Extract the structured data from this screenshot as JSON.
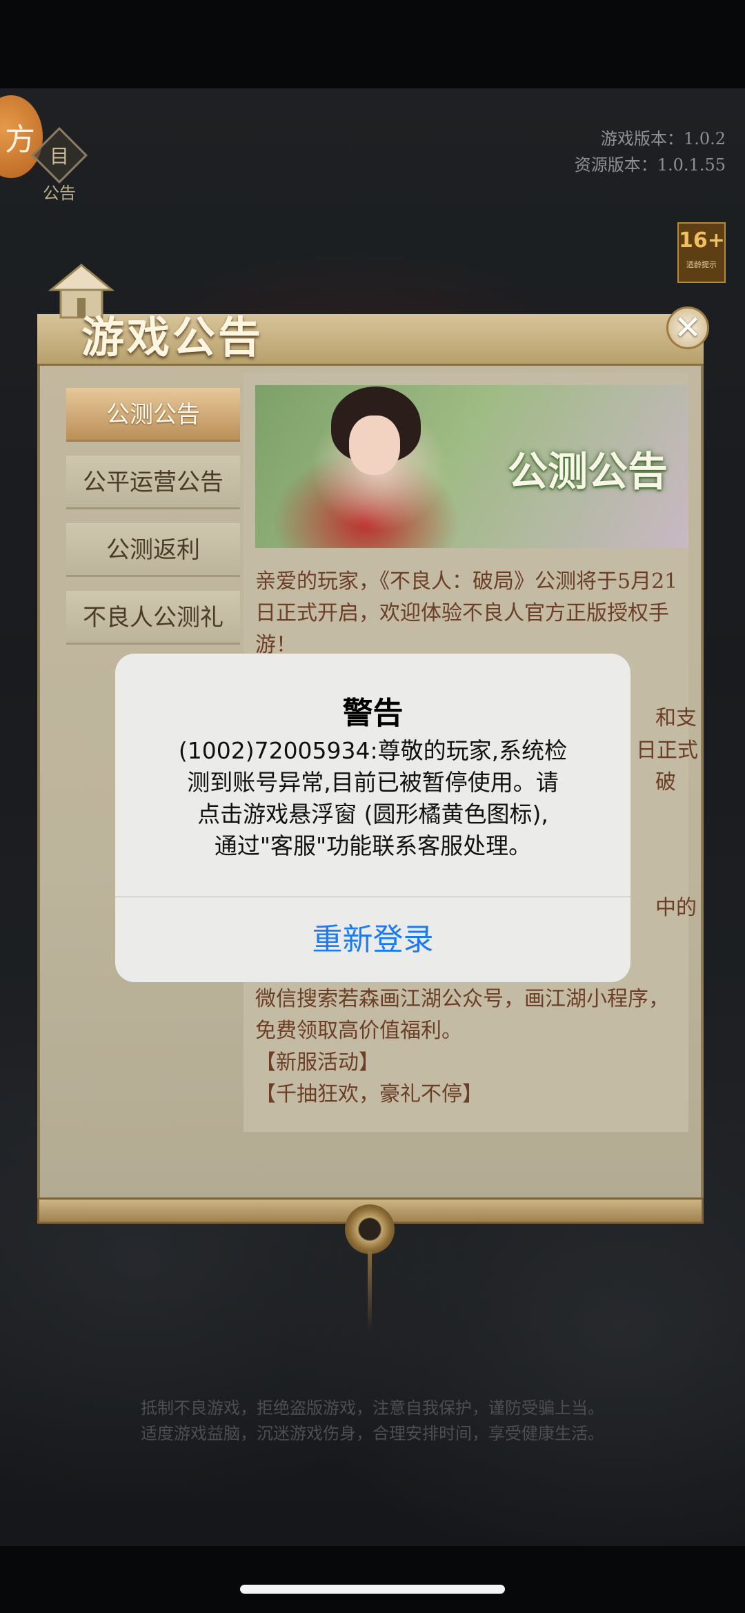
{
  "game": {
    "fang_badge": "方",
    "notice_icon_glyph": "目",
    "notice_label": "公告",
    "version_game": "游戏版本：1.0.2",
    "version_resource": "资源版本：1.0.1.55",
    "age_rating": "16+",
    "age_hint": "适龄提示"
  },
  "announcement": {
    "title": "游戏公告",
    "close_symbol": "✕",
    "tabs": [
      {
        "label": "公测公告",
        "active": true
      },
      {
        "label": "公平运营公告",
        "active": false
      },
      {
        "label": "公测返利",
        "active": false
      },
      {
        "label": "不良人公测礼",
        "active": false
      }
    ],
    "banner_title": "公测公告",
    "paragraphs": [
      "亲爱的玩家，《不良人：破局》公测将于5月21日正式开启，欢迎体验不良人官方正版授权手游！"
    ],
    "fragments": [
      "和支",
      "日正式",
      "破",
      "中的"
    ],
    "lower_paragraphs": [
      "微信搜索若森画江湖公众号，画江湖小程序，免费领取高价值福利。",
      "【新服活动】",
      "【千抽狂欢，豪礼不停】"
    ]
  },
  "health_notice": [
    "抵制不良游戏，拒绝盗版游戏，注意自我保护，谨防受骗上当。",
    "适度游戏益脑，沉迷游戏伤身，合理安排时间，享受健康生活。"
  ],
  "alert": {
    "title": "警告",
    "message_lines": [
      "(1002)72005934:尊敬的玩家,系统检",
      "测到账号异常,目前已被暂停使用。请",
      "点击游戏悬浮窗 (圆形橘黄色图标),",
      "通过\"客服\"功能联系客服处理。"
    ],
    "button_label": "重新登录",
    "button_color": "#1a7cf5"
  }
}
